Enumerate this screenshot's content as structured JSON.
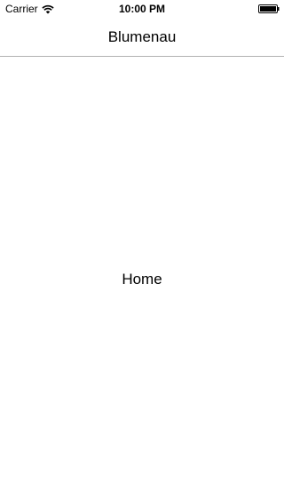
{
  "status_bar": {
    "carrier": "Carrier",
    "time": "10:00 PM",
    "wifi_icon": "wifi-icon",
    "battery_icon": "battery-icon"
  },
  "nav_bar": {
    "title": "Blumenau"
  },
  "main": {
    "label": "Home"
  }
}
